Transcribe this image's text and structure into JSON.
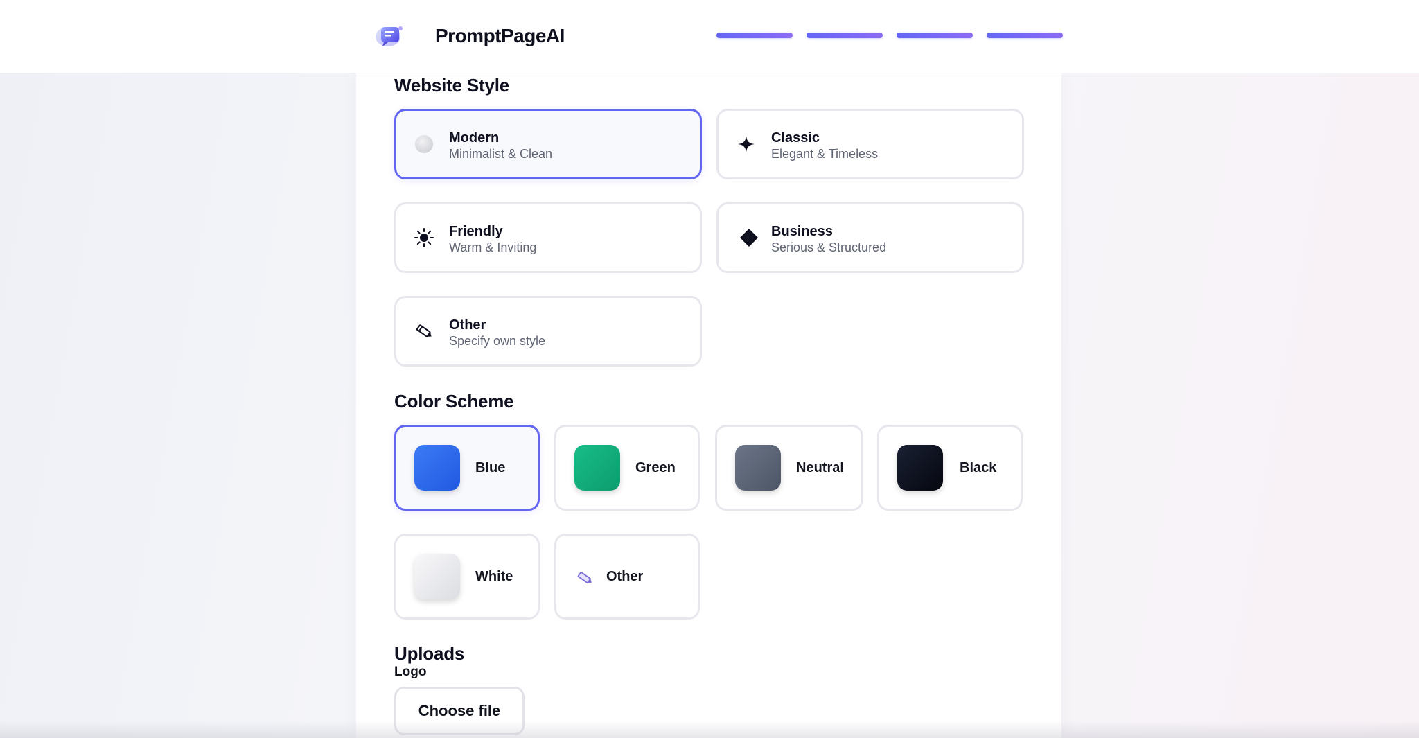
{
  "header": {
    "brand": "PromptPageAI",
    "progress_steps": 4
  },
  "website_style": {
    "title": "Website Style",
    "options": [
      {
        "name": "Modern",
        "desc": "Minimalist & Clean",
        "icon": "circle-icon",
        "selected": true
      },
      {
        "name": "Classic",
        "desc": "Elegant & Timeless",
        "icon": "sparkle-icon",
        "selected": false
      },
      {
        "name": "Friendly",
        "desc": "Warm & Inviting",
        "icon": "sun-icon",
        "selected": false
      },
      {
        "name": "Business",
        "desc": "Serious & Structured",
        "icon": "diamond-icon",
        "selected": false
      },
      {
        "name": "Other",
        "desc": "Specify own style",
        "icon": "pencil-icon",
        "selected": false
      }
    ]
  },
  "color_scheme": {
    "title": "Color Scheme",
    "options": [
      {
        "name": "Blue",
        "color": "#2f6ef2",
        "selected": true
      },
      {
        "name": "Green",
        "color": "#13b07e",
        "selected": false
      },
      {
        "name": "Neutral",
        "color": "#5d6779",
        "selected": false
      },
      {
        "name": "Black",
        "color": "#0c1222",
        "selected": false
      },
      {
        "name": "White",
        "color": "#ececef",
        "selected": false
      },
      {
        "name": "Other",
        "icon": "pencil-icon",
        "selected": false
      }
    ]
  },
  "uploads": {
    "title": "Uploads",
    "logo_label": "Logo",
    "choose_file": "Choose file"
  },
  "colors": {
    "accent": "#6366f1"
  }
}
